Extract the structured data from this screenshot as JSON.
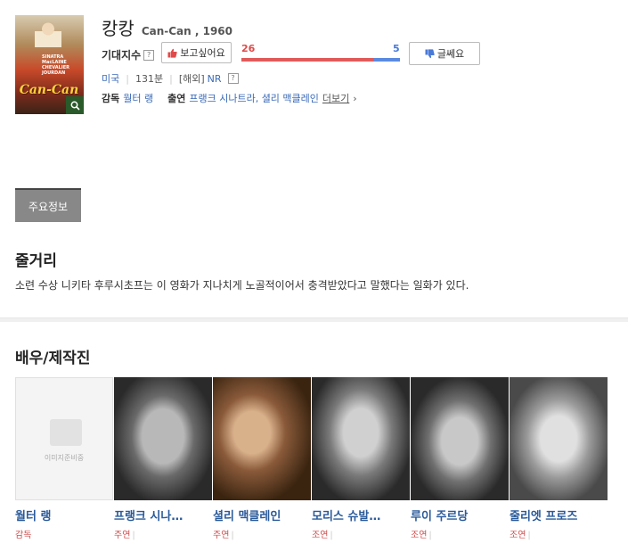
{
  "movie": {
    "title_kr": "캉캉",
    "title_en": "Can-Can , 1960",
    "poster_art_text": "Can-Can",
    "poster_cast_text": "SINATRA MacLAINE CHEVALIER JOURDAN"
  },
  "expectation": {
    "label": "기대지수",
    "help": "?",
    "like_label": "보고싶어요",
    "dislike_label": "글쎄요",
    "like_count": "26",
    "dislike_count": "5",
    "like_fraction": 0.839
  },
  "meta": {
    "country": "미국",
    "runtime": "131분",
    "rating_prefix": "[해외]",
    "rating": "NR",
    "rating_help": "?"
  },
  "credits": {
    "director_label": "감독",
    "director": "월터 랭",
    "cast_label": "출연",
    "cast": "프랭크 시나트라, 셜리 맥클레인",
    "more": "더보기",
    "more_arrow": "›"
  },
  "tabs": {
    "main_info": "주요정보"
  },
  "synopsis": {
    "heading": "줄거리",
    "text": "소련 수상 니키타 후루시초프는 이 영화가 지나치게 노골적이어서 충격받았다고 말했다는 일화가 있다."
  },
  "cast_section": {
    "heading": "배우/제작진",
    "placeholder_text": "이미지준비중",
    "people": [
      {
        "name": "월터 랭",
        "role": "감독",
        "photo": "none"
      },
      {
        "name": "프랭크 시나…",
        "role": "주연",
        "photo": "p1"
      },
      {
        "name": "셜리 맥클레인",
        "role": "주연",
        "photo": "p2"
      },
      {
        "name": "모리스 슈발…",
        "role": "조연",
        "photo": "p3"
      },
      {
        "name": "루이 주르당",
        "role": "조연",
        "photo": "p4"
      },
      {
        "name": "줄리엣 프로즈",
        "role": "조연",
        "photo": "p5"
      }
    ]
  },
  "colors": {
    "accent_blue": "#3a6ab8",
    "like_red": "#e05a5a",
    "dislike_blue": "#5a8ae0",
    "role_red": "#d04a4a"
  }
}
